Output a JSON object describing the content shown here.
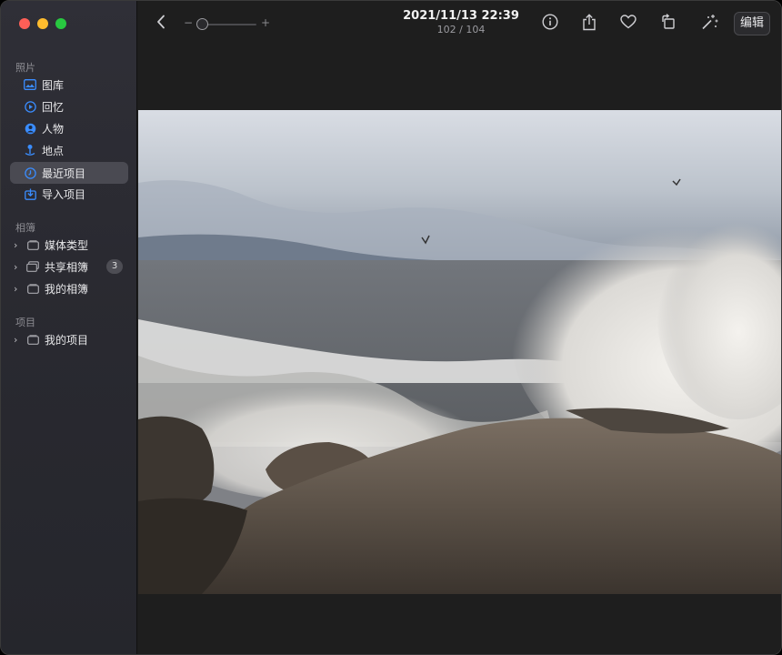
{
  "window": {
    "traffic_lights": [
      "close",
      "minimize",
      "maximize"
    ],
    "colors": {
      "close": "#fe5f57",
      "minimize": "#febc2e",
      "maximize": "#28c840",
      "accent": "#3a8dff"
    }
  },
  "sidebar": {
    "sections": [
      {
        "label": "照片",
        "items": [
          {
            "label": "图库",
            "icon": "photo-library-icon"
          },
          {
            "label": "回忆",
            "icon": "memories-icon"
          },
          {
            "label": "人物",
            "icon": "people-icon"
          },
          {
            "label": "地点",
            "icon": "places-icon"
          },
          {
            "label": "最近项目",
            "icon": "recents-icon",
            "selected": true
          },
          {
            "label": "导入项目",
            "icon": "imports-icon"
          }
        ]
      },
      {
        "label": "相簿",
        "items": [
          {
            "label": "媒体类型",
            "icon": "folder-icon"
          },
          {
            "label": "共享相簿",
            "icon": "shared-folder-icon",
            "badge": "3"
          },
          {
            "label": "我的相簿",
            "icon": "folder-icon"
          }
        ]
      },
      {
        "label": "项目",
        "items": [
          {
            "label": "我的项目",
            "icon": "folder-icon"
          }
        ]
      }
    ]
  },
  "toolbar": {
    "back_icon": "chevron-left-icon",
    "zoom_minus": "−",
    "zoom_plus": "+",
    "zoom_level": 0,
    "title": "2021/11/13 22:39",
    "subtitle": "102 / 104",
    "actions": [
      "info-icon",
      "share-icon",
      "heart-icon",
      "rotate-icon",
      "magic-wand-icon"
    ],
    "edit_label": "编辑"
  },
  "viewer": {
    "photo_description_icon": "seascape-photo"
  }
}
